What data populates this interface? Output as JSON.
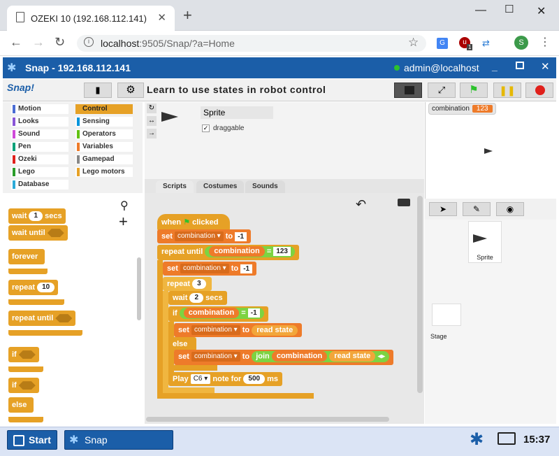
{
  "browser": {
    "tab_title": "OZEKI 10 (192.168.112.141)",
    "url_host": "localhost",
    "url_rest": ":9505/Snap/?a=Home",
    "extension_badge": "1",
    "profile_initial": "S"
  },
  "snap": {
    "window_title": "Snap - 192.168.112.141",
    "user": "admin@localhost",
    "logo": "Snap!",
    "project_name": "Learn to use states in robot control",
    "categories": [
      {
        "label": "Motion",
        "color": "#4a6cd4"
      },
      {
        "label": "Control",
        "color": "#e6a126",
        "selected": true
      },
      {
        "label": "Looks",
        "color": "#8a55d7"
      },
      {
        "label": "Sensing",
        "color": "#0494dc"
      },
      {
        "label": "Sound",
        "color": "#cf4ad9"
      },
      {
        "label": "Operators",
        "color": "#62c213"
      },
      {
        "label": "Pen",
        "color": "#00a178"
      },
      {
        "label": "Variables",
        "color": "#ee7b2a"
      },
      {
        "label": "Ozeki",
        "color": "#e0201b"
      },
      {
        "label": "Gamepad",
        "color": "#888888"
      },
      {
        "label": "Lego",
        "color": "#2a9d2a"
      },
      {
        "label": "Lego motors",
        "color": "#e6a126"
      },
      {
        "label": "Database",
        "color": "#2caad8"
      }
    ],
    "palette": {
      "wait": "wait",
      "wait_num": "1",
      "secs": "secs",
      "wait_until": "wait until",
      "forever": "forever",
      "repeat": "repeat",
      "repeat_num": "10",
      "repeat_until": "repeat until",
      "if": "if",
      "else": "else"
    },
    "sprite": {
      "name": "Sprite",
      "draggable_label": "draggable"
    },
    "tabs": [
      "Scripts",
      "Costumes",
      "Sounds"
    ],
    "script": {
      "when": "when",
      "clicked": "clicked",
      "set": "set",
      "var": "combination",
      "to": "to",
      "minus_one": "-1",
      "repeat_until": "repeat until",
      "eq": "=",
      "num_123": "123",
      "repeat": "repeat",
      "repeat_n": "3",
      "wait": "wait",
      "wait_n": "2",
      "secs": "secs",
      "if": "if",
      "read_state": "read state",
      "else": "else",
      "join": "join",
      "play": "Play",
      "note": "C6",
      "note_for": "note for",
      "duration": "500",
      "ms": "ms"
    },
    "watcher": {
      "label": "combination",
      "value": "123"
    },
    "corral": {
      "sprite_label": "Sprite",
      "stage_label": "Stage"
    }
  },
  "taskbar": {
    "start": "Start",
    "app": "Snap",
    "clock": "15:37"
  }
}
